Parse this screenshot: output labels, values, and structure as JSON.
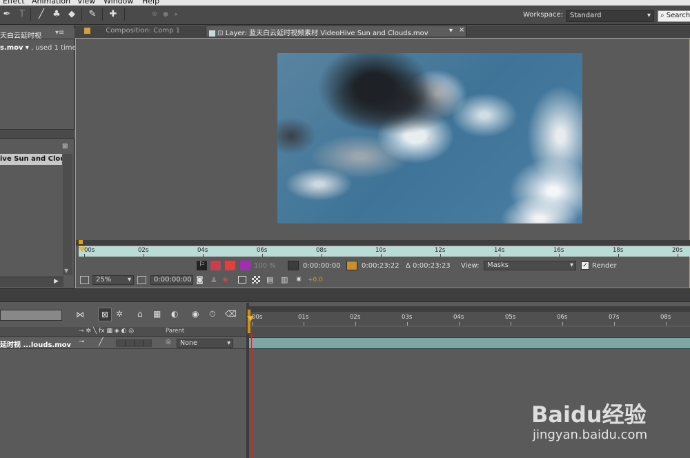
{
  "menu": {
    "items": [
      "Effect",
      "Animation",
      "View",
      "Window",
      "Help"
    ]
  },
  "workspace": {
    "label": "Workspace:",
    "value": "Standard",
    "search_placeholder": "Search"
  },
  "project": {
    "tab_label": "天白云延时视",
    "item_name": "s.mov",
    "item_usage": ", used 1 time",
    "list_item": "ive Sun and Cloud"
  },
  "viewer": {
    "tab_comp": "Composition: Comp 1",
    "tab_layer": "Layer: 蓝天白云延时视频素材 VideoHive Sun and Clouds.mov"
  },
  "layer_ruler": {
    "labels": [
      "00s",
      "02s",
      "04s",
      "06s",
      "08s",
      "10s",
      "12s",
      "14s",
      "16s",
      "18s",
      "20s"
    ]
  },
  "layer_controls": {
    "opacity": "100 %",
    "in_time": "0:00:00:00",
    "out_time": "0:00:23:22",
    "duration": "Δ 0:00:23:23",
    "view_label": "View:",
    "view_value": "Masks",
    "render_label": "Render"
  },
  "comp_controls": {
    "zoom": "25%",
    "timecode": "0:00:00:00",
    "exposure": "+0.0"
  },
  "timeline": {
    "parent_header": "Parent",
    "layer_name": "延时视 ...louds.mov",
    "parent_value": "None",
    "ruler": [
      "00s",
      "01s",
      "02s",
      "03s",
      "04s",
      "05s",
      "06s",
      "07s",
      "08s"
    ]
  },
  "colors": {
    "accent": "#e8b43a",
    "ruler_bg": "#b9dcd9",
    "playhead": "#e02020"
  },
  "watermark": {
    "text": "Baidu经验",
    "url": "jingyan.baidu.com"
  }
}
